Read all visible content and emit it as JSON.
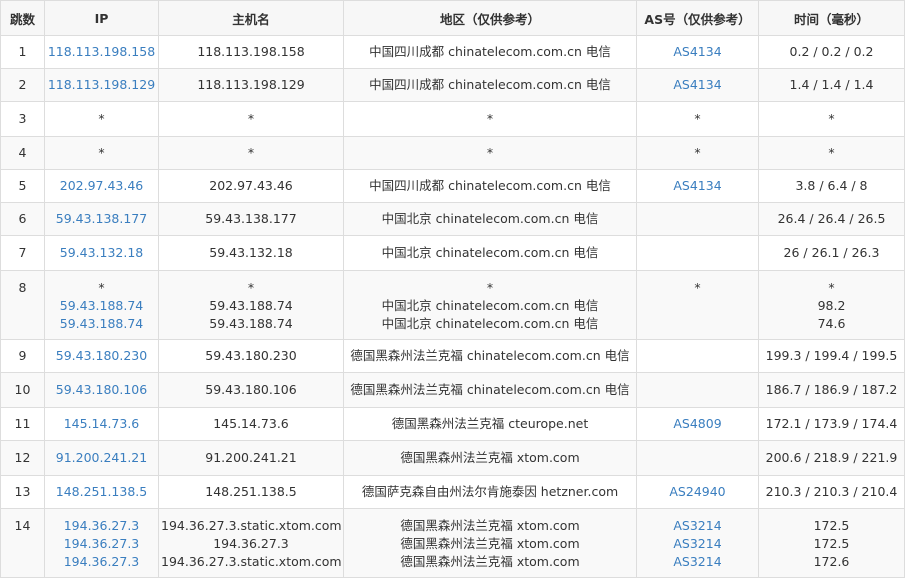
{
  "headers": {
    "hop": "跳数",
    "ip": "IP",
    "host": "主机名",
    "region": "地区（仅供参考）",
    "as": "AS号（仅供参考）",
    "time": "时间（毫秒）"
  },
  "rows": [
    {
      "hop": "1",
      "ip": [
        "118.113.198.158"
      ],
      "host": [
        "118.113.198.158"
      ],
      "region": [
        "中国四川成都 chinatelecom.com.cn 电信"
      ],
      "as": [
        "AS4134"
      ],
      "time": [
        "0.2 / 0.2 / 0.2"
      ]
    },
    {
      "hop": "2",
      "ip": [
        "118.113.198.129"
      ],
      "host": [
        "118.113.198.129"
      ],
      "region": [
        "中国四川成都 chinatelecom.com.cn 电信"
      ],
      "as": [
        "AS4134"
      ],
      "time": [
        "1.4 / 1.4 / 1.4"
      ]
    },
    {
      "hop": "3",
      "ip": [
        "*"
      ],
      "host": [
        "*"
      ],
      "region": [
        "*"
      ],
      "as": [
        "*"
      ],
      "time": [
        "*"
      ]
    },
    {
      "hop": "4",
      "ip": [
        "*"
      ],
      "host": [
        "*"
      ],
      "region": [
        "*"
      ],
      "as": [
        "*"
      ],
      "time": [
        "*"
      ]
    },
    {
      "hop": "5",
      "ip": [
        "202.97.43.46"
      ],
      "host": [
        "202.97.43.46"
      ],
      "region": [
        "中国四川成都 chinatelecom.com.cn 电信"
      ],
      "as": [
        "AS4134"
      ],
      "time": [
        "3.8 / 6.4 / 8"
      ]
    },
    {
      "hop": "6",
      "ip": [
        "59.43.138.177"
      ],
      "host": [
        "59.43.138.177"
      ],
      "region": [
        "中国北京 chinatelecom.com.cn 电信"
      ],
      "as": [
        ""
      ],
      "time": [
        "26.4 / 26.4 / 26.5"
      ]
    },
    {
      "hop": "7",
      "ip": [
        "59.43.132.18"
      ],
      "host": [
        "59.43.132.18"
      ],
      "region": [
        "中国北京 chinatelecom.com.cn 电信"
      ],
      "as": [
        ""
      ],
      "time": [
        "26 / 26.1 / 26.3"
      ]
    },
    {
      "hop": "8",
      "ip": [
        "*",
        "59.43.188.74",
        "59.43.188.74"
      ],
      "host": [
        "*",
        "59.43.188.74",
        "59.43.188.74"
      ],
      "region": [
        "*",
        "中国北京 chinatelecom.com.cn 电信",
        "中国北京 chinatelecom.com.cn 电信"
      ],
      "as": [
        "*",
        "",
        ""
      ],
      "time": [
        "*",
        "98.2",
        "74.6"
      ]
    },
    {
      "hop": "9",
      "ip": [
        "59.43.180.230"
      ],
      "host": [
        "59.43.180.230"
      ],
      "region": [
        "德国黑森州法兰克福 chinatelecom.com.cn 电信"
      ],
      "as": [
        ""
      ],
      "time": [
        "199.3 / 199.4 / 199.5"
      ]
    },
    {
      "hop": "10",
      "ip": [
        "59.43.180.106"
      ],
      "host": [
        "59.43.180.106"
      ],
      "region": [
        "德国黑森州法兰克福 chinatelecom.com.cn 电信"
      ],
      "as": [
        ""
      ],
      "time": [
        "186.7 / 186.9 / 187.2"
      ]
    },
    {
      "hop": "11",
      "ip": [
        "145.14.73.6"
      ],
      "host": [
        "145.14.73.6"
      ],
      "region": [
        "德国黑森州法兰克福 cteurope.net"
      ],
      "as": [
        "AS4809"
      ],
      "time": [
        "172.1 / 173.9 / 174.4"
      ]
    },
    {
      "hop": "12",
      "ip": [
        "91.200.241.21"
      ],
      "host": [
        "91.200.241.21"
      ],
      "region": [
        "德国黑森州法兰克福 xtom.com"
      ],
      "as": [
        ""
      ],
      "time": [
        "200.6 / 218.9 / 221.9"
      ]
    },
    {
      "hop": "13",
      "ip": [
        "148.251.138.5"
      ],
      "host": [
        "148.251.138.5"
      ],
      "region": [
        "德国萨克森自由州法尔肯施泰因 hetzner.com"
      ],
      "as": [
        "AS24940"
      ],
      "time": [
        "210.3 / 210.3 / 210.4"
      ]
    },
    {
      "hop": "14",
      "ip": [
        "194.36.27.3",
        "194.36.27.3",
        "194.36.27.3"
      ],
      "host": [
        "194.36.27.3.static.xtom.com",
        "194.36.27.3",
        "194.36.27.3.static.xtom.com"
      ],
      "region": [
        "德国黑森州法兰克福 xtom.com",
        "德国黑森州法兰克福 xtom.com",
        "德国黑森州法兰克福 xtom.com"
      ],
      "as": [
        "AS3214",
        "AS3214",
        "AS3214"
      ],
      "time": [
        "172.5",
        "172.5",
        "172.6"
      ]
    }
  ]
}
